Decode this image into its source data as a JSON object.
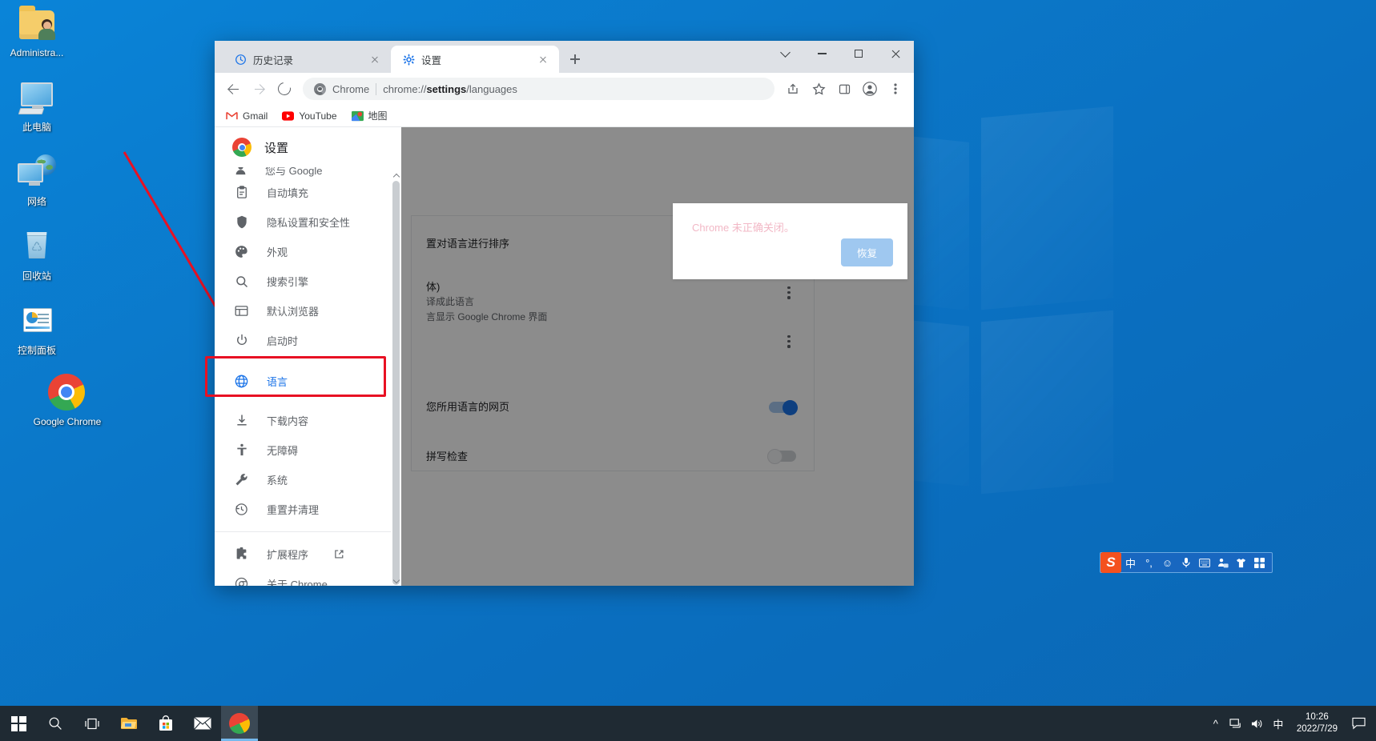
{
  "desktop": {
    "icons": [
      {
        "name": "Administra...",
        "icon": "user-folder-icon"
      },
      {
        "name": "此电脑",
        "icon": "this-pc-icon"
      },
      {
        "name": "网络",
        "icon": "network-icon"
      },
      {
        "name": "回收站",
        "icon": "recycle-bin-icon"
      },
      {
        "name": "控制面板",
        "icon": "control-panel-icon"
      },
      {
        "name": "Google Chrome",
        "icon": "chrome-icon"
      }
    ]
  },
  "browser": {
    "tabs": [
      {
        "title": "历史记录",
        "icon": "history-icon",
        "active": false
      },
      {
        "title": "设置",
        "icon": "gear-icon",
        "active": true
      }
    ],
    "new_tab_label": "+",
    "window_controls": {
      "search_tabs": "v",
      "minimize": "–",
      "maximize": "□",
      "close": "×"
    },
    "toolbar": {
      "back": "←",
      "forward": "→",
      "reload": "⟳",
      "share": "share-icon",
      "bookmark": "star-icon",
      "sidepanel": "side-panel-icon",
      "profile": "profile-icon",
      "menu": "three-dot-menu-icon"
    },
    "omnibox": {
      "scheme_label": "Chrome",
      "url_prefix": "chrome://",
      "url_bold": "settings",
      "url_suffix": "/languages",
      "full_url": "chrome://settings/languages"
    },
    "bookmarks": [
      {
        "label": "Gmail",
        "icon": "gmail-icon"
      },
      {
        "label": "YouTube",
        "icon": "youtube-icon"
      },
      {
        "label": "地图",
        "icon": "maps-icon"
      }
    ]
  },
  "settings": {
    "header_title": "设置",
    "sidebar_items": [
      {
        "label": "您与 Google",
        "icon": "person-icon",
        "selected": false,
        "clipped": true
      },
      {
        "label": "自动填充",
        "icon": "autofill-icon",
        "selected": false
      },
      {
        "label": "隐私设置和安全性",
        "icon": "shield-icon",
        "selected": false
      },
      {
        "label": "外观",
        "icon": "palette-icon",
        "selected": false
      },
      {
        "label": "搜索引擎",
        "icon": "search-icon",
        "selected": false
      },
      {
        "label": "默认浏览器",
        "icon": "browser-icon",
        "selected": false
      },
      {
        "label": "启动时",
        "icon": "power-icon",
        "selected": false
      },
      {
        "label": "语言",
        "icon": "globe-icon",
        "selected": true
      },
      {
        "label": "下载内容",
        "icon": "download-icon",
        "selected": false
      },
      {
        "label": "无障碍",
        "icon": "accessibility-icon",
        "selected": false
      },
      {
        "label": "系统",
        "icon": "wrench-icon",
        "selected": false
      },
      {
        "label": "重置并清理",
        "icon": "restore-icon",
        "selected": false
      }
    ],
    "sidebar_footer": [
      {
        "label": "扩展程序",
        "icon": "extension-icon",
        "external": true
      },
      {
        "label": "关于 Chrome",
        "icon": "chrome-circle-icon",
        "external": false
      }
    ],
    "content": {
      "order_hint": "置对语言进行排序",
      "lang_variant": "体)",
      "translate_option": "译成此语言",
      "ui_option": "言显示 Google Chrome 界面",
      "translate_pages": "您所用语言的网页",
      "spellcheck": "拼写检查",
      "toggle_translate_on": true,
      "toggle_spellcheck_on": false
    }
  },
  "dialog": {
    "message": "Chrome 未正确关闭。",
    "restore_button": "恢复"
  },
  "annotation": {
    "highlight_target": "语言",
    "color": "#e81123"
  },
  "ime": {
    "name": "搜狗输入法",
    "logo": "S",
    "items": [
      "中",
      "°,",
      "smiley-icon",
      "microphone-icon",
      "keyboard-icon",
      "toolbox-icon",
      "skin-icon",
      "apps-icon"
    ]
  },
  "taskbar": {
    "items": [
      {
        "name": "start-button",
        "icon": "windows-logo-icon"
      },
      {
        "name": "search-button",
        "icon": "search-icon"
      },
      {
        "name": "task-view-button",
        "icon": "task-view-icon"
      },
      {
        "name": "file-explorer-button",
        "icon": "folder-icon"
      },
      {
        "name": "microsoft-store-button",
        "icon": "store-icon"
      },
      {
        "name": "mail-button",
        "icon": "mail-icon"
      },
      {
        "name": "chrome-taskbar-button",
        "icon": "chrome-icon"
      }
    ],
    "tray": {
      "overflow": "^",
      "network": "network-icon",
      "volume": "volume-icon",
      "ime_mode": "中",
      "time": "10:26",
      "date": "2022/7/29",
      "action_center": "action-center-icon"
    }
  }
}
